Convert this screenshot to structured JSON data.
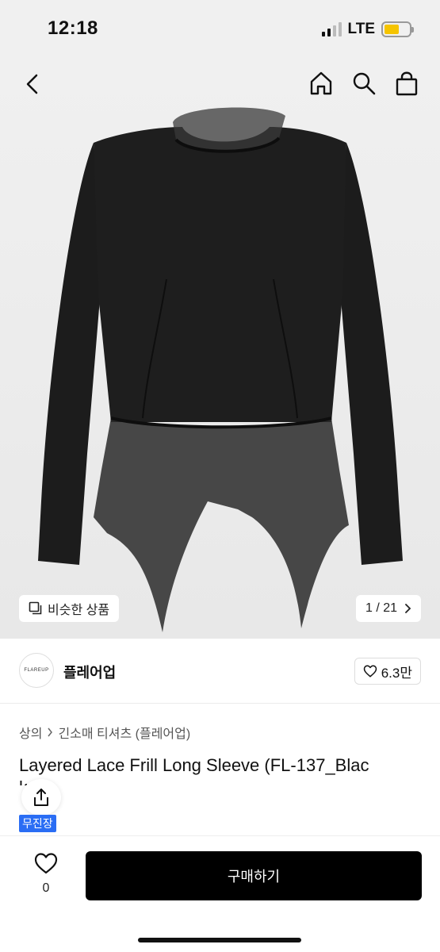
{
  "status_bar": {
    "time": "12:18",
    "network": "LTE"
  },
  "nav": {
    "icons": [
      "back-icon",
      "home-icon",
      "search-icon",
      "shopping-bag-icon"
    ]
  },
  "gallery": {
    "similar_label": "비슷한 상품",
    "page_indicator": "1 / 21"
  },
  "brand": {
    "logo_text": "FLAREUP",
    "name": "플레어업",
    "likes": "6.3만"
  },
  "breadcrumb": {
    "category": "상의",
    "subcategory": "긴소매 티셔츠 (플레어업)"
  },
  "product": {
    "title": "Layered Lace Frill Long Sleeve (FL-137_Blac",
    "title_overflow": "k)",
    "badge": "무진장"
  },
  "bottom_bar": {
    "wish_count": "0",
    "buy_label": "구매하기"
  },
  "colors": {
    "buy_button": "#000000",
    "badge": "#2a6df4",
    "battery": "#f5c400"
  }
}
